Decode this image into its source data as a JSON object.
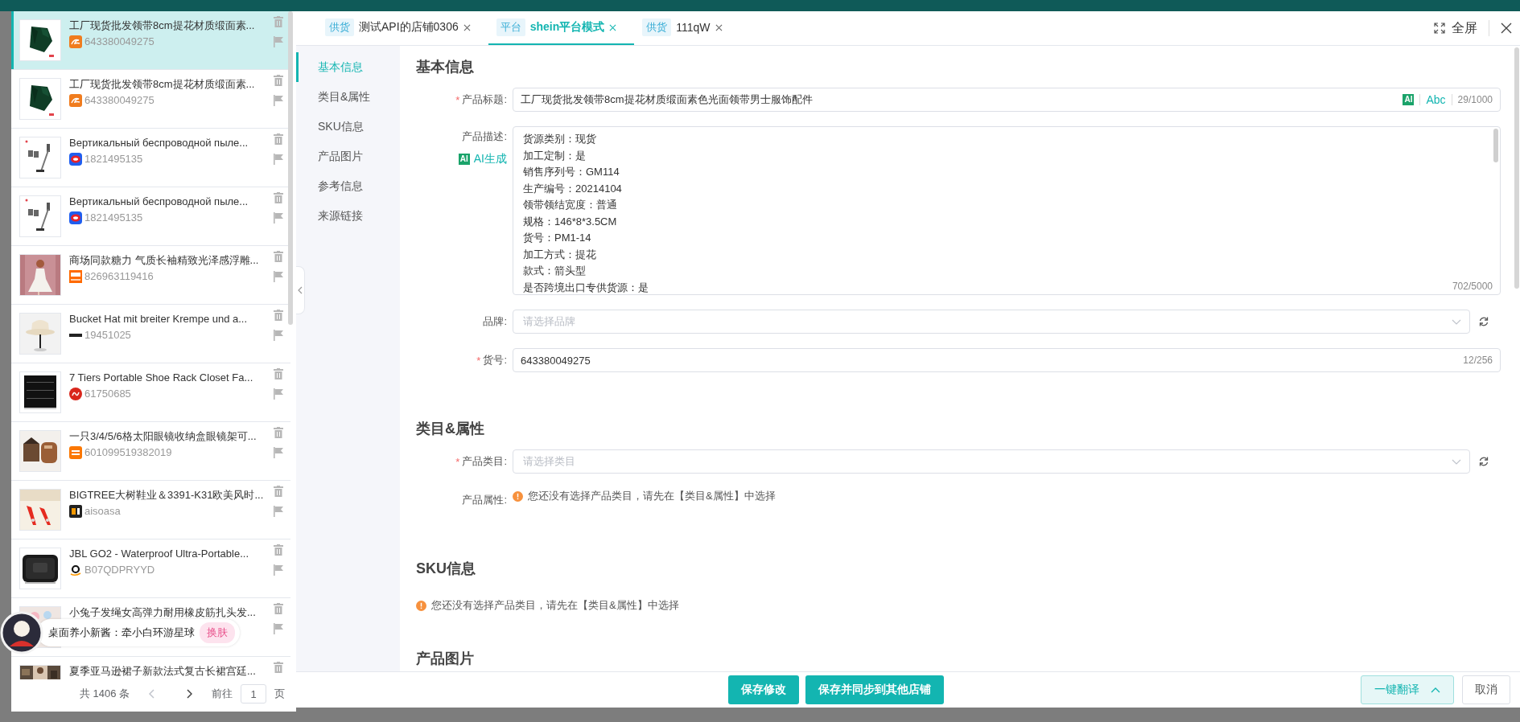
{
  "products": [
    {
      "title": "工厂现货批发领带8cm提花材质缎面素...",
      "source": {
        "kind": "alibaba"
      },
      "code": "643380049275",
      "selected": true
    },
    {
      "title": "工厂现货批发领带8cm提花材质缎面素...",
      "source": {
        "kind": "alibaba"
      },
      "code": "643380049275",
      "selected": false
    },
    {
      "title": "Вертикальный беспроводной пыле...",
      "source": {
        "kind": "pdd"
      },
      "code": "1821495135",
      "selected": false
    },
    {
      "title": "Вертикальный беспроводной пыле...",
      "source": {
        "kind": "pdd"
      },
      "code": "1821495135",
      "selected": false
    },
    {
      "title": "商场同款糖力 气质长袖精致光泽感浮雕...",
      "source": {
        "kind": "taobao"
      },
      "code": "826963119416",
      "selected": false
    },
    {
      "title": "Bucket Hat mit breiter Krempe und a...",
      "source": {
        "kind": "shein"
      },
      "code": "19451025",
      "selected": false
    },
    {
      "title": "7 Tiers Portable Shoe Rack Closet Fa...",
      "source": {
        "kind": "sy"
      },
      "code": "61750685",
      "selected": false
    },
    {
      "title": "一只3/4/5/6格太阳眼镜收纳盒眼镜架可...",
      "source": {
        "kind": "temu"
      },
      "code": "601099519382019",
      "selected": false
    },
    {
      "title": "BIGTREE大树鞋业＆3391-K31欧美风时...",
      "source": {
        "kind": "go2"
      },
      "code": "aisoasa",
      "selected": false
    },
    {
      "title": "JBL GO2 - Waterproof Ultra-Portable...",
      "source": {
        "kind": "amazon"
      },
      "code": "B07QDPRYYD",
      "selected": false
    },
    {
      "title": "小兔子发绳女高弹力耐用橡皮筋扎头发...",
      "selected": false
    },
    {
      "title": "夏季亚马逊裙子新款法式复古长裙宫廷...",
      "selected": false
    }
  ],
  "pagination": {
    "total": "共 1406 条",
    "goto": "前往",
    "page": "1",
    "unit": "页"
  },
  "pet_widget": {
    "text": "桌面养小新酱：牵小白环游星球",
    "button": "换肤"
  },
  "tabs": [
    {
      "tag": "供货",
      "label": "测试API的店铺0306",
      "selected": false
    },
    {
      "tag": "平台",
      "label": "shein平台模式",
      "selected": true
    },
    {
      "tag": "供货",
      "label": "111qW",
      "selected": false
    }
  ],
  "fullscreen": "全屏",
  "nav": [
    {
      "label": "基本信息",
      "selected": true
    },
    {
      "label": "类目&属性",
      "selected": false
    },
    {
      "label": "SKU信息",
      "selected": false
    },
    {
      "label": "产品图片",
      "selected": false
    },
    {
      "label": "参考信息",
      "selected": false
    },
    {
      "label": "来源链接",
      "selected": false
    }
  ],
  "required_mark": "*",
  "sections": [
    {
      "heading": "基本信息",
      "fields": [
        {
          "kind": "text",
          "label": "产品标题:",
          "required": true,
          "value": "工厂现货批发领带8cm提花材质缎面素色光面领带男士服饰配件",
          "ai_badge": "AI",
          "tool": "Abc",
          "count": "29/1000"
        },
        {
          "kind": "textarea",
          "label": "产品描述:",
          "required": false,
          "ai_badge": "AI",
          "ai_label": "AI生成",
          "lines": [
            "货源类别：现货",
            "加工定制：是",
            "销售序列号：GM114",
            "生产编号：20214104",
            "领带领结宽度：普通",
            "规格：146*8*3.5CM",
            "货号：PM1-14",
            "加工方式：提花",
            "款式：箭头型",
            "是否跨境出口专供货源：是"
          ],
          "count": "702/5000"
        },
        {
          "kind": "select",
          "label": "品牌:",
          "required": false,
          "placeholder": "请选择品牌"
        },
        {
          "kind": "text",
          "label": "货号:",
          "required": true,
          "value": "643380049275",
          "count": "12/256"
        }
      ]
    },
    {
      "heading": "类目&属性",
      "fields": [
        {
          "kind": "select",
          "label": "产品类目:",
          "required": true,
          "placeholder": "请选择类目"
        },
        {
          "kind": "notice",
          "label": "产品属性:",
          "text": "您还没有选择产品类目，请先在【类目&属性】中选择"
        }
      ]
    },
    {
      "heading": "SKU信息",
      "fields": [
        {
          "kind": "notice",
          "text": "您还没有选择产品类目，请先在【类目&属性】中选择"
        }
      ]
    },
    {
      "heading": "产品图片"
    }
  ],
  "footer": {
    "primary": [
      "保存修改",
      "保存并同步到其他店铺"
    ],
    "translate": "一键翻译",
    "cancel": "取消"
  }
}
